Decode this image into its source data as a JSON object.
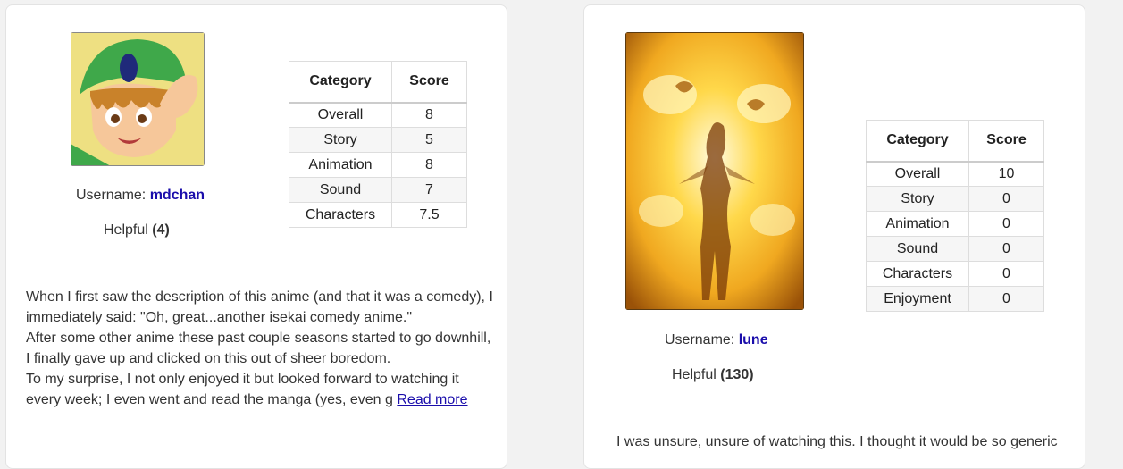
{
  "reviews": [
    {
      "avatar_icon": "anime-avatar-green-hat-boy",
      "username_label": "Username:",
      "username": "mdchan",
      "helpful_label": "Helpful",
      "helpful_count": "(4)",
      "table": {
        "col_category": "Category",
        "col_score": "Score",
        "rows": [
          {
            "category": "Overall",
            "score": "8"
          },
          {
            "category": "Story",
            "score": "5"
          },
          {
            "category": "Animation",
            "score": "8"
          },
          {
            "category": "Sound",
            "score": "7"
          },
          {
            "category": "Characters",
            "score": "7.5"
          }
        ]
      },
      "text_lines": [
        "When I first saw the description of this anime (and that it was a comedy), I",
        "immediately said:  \"Oh, great...another isekai comedy anime.\"",
        "After some other anime these past couple seasons started to go downhill,",
        "I finally gave up and clicked on this out of sheer boredom.",
        "To my surprise, I not only enjoyed it but looked forward to watching it",
        "every week; I even went and read the manga (yes, even g"
      ],
      "read_more": "Read more"
    },
    {
      "avatar_icon": "anime-avatar-glowing-figure",
      "username_label": "Username:",
      "username": "lune",
      "helpful_label": "Helpful",
      "helpful_count": "(130)",
      "table": {
        "col_category": "Category",
        "col_score": "Score",
        "rows": [
          {
            "category": "Overall",
            "score": "10"
          },
          {
            "category": "Story",
            "score": "0"
          },
          {
            "category": "Animation",
            "score": "0"
          },
          {
            "category": "Sound",
            "score": "0"
          },
          {
            "category": "Characters",
            "score": "0"
          },
          {
            "category": "Enjoyment",
            "score": "0"
          }
        ]
      },
      "text_lines": [
        "I was unsure, unsure of watching this. I thought it would be so generic"
      ]
    }
  ],
  "colors": {
    "link": "#1a0dab",
    "page_bg": "#f2f2f2",
    "card_bg": "#ffffff"
  }
}
